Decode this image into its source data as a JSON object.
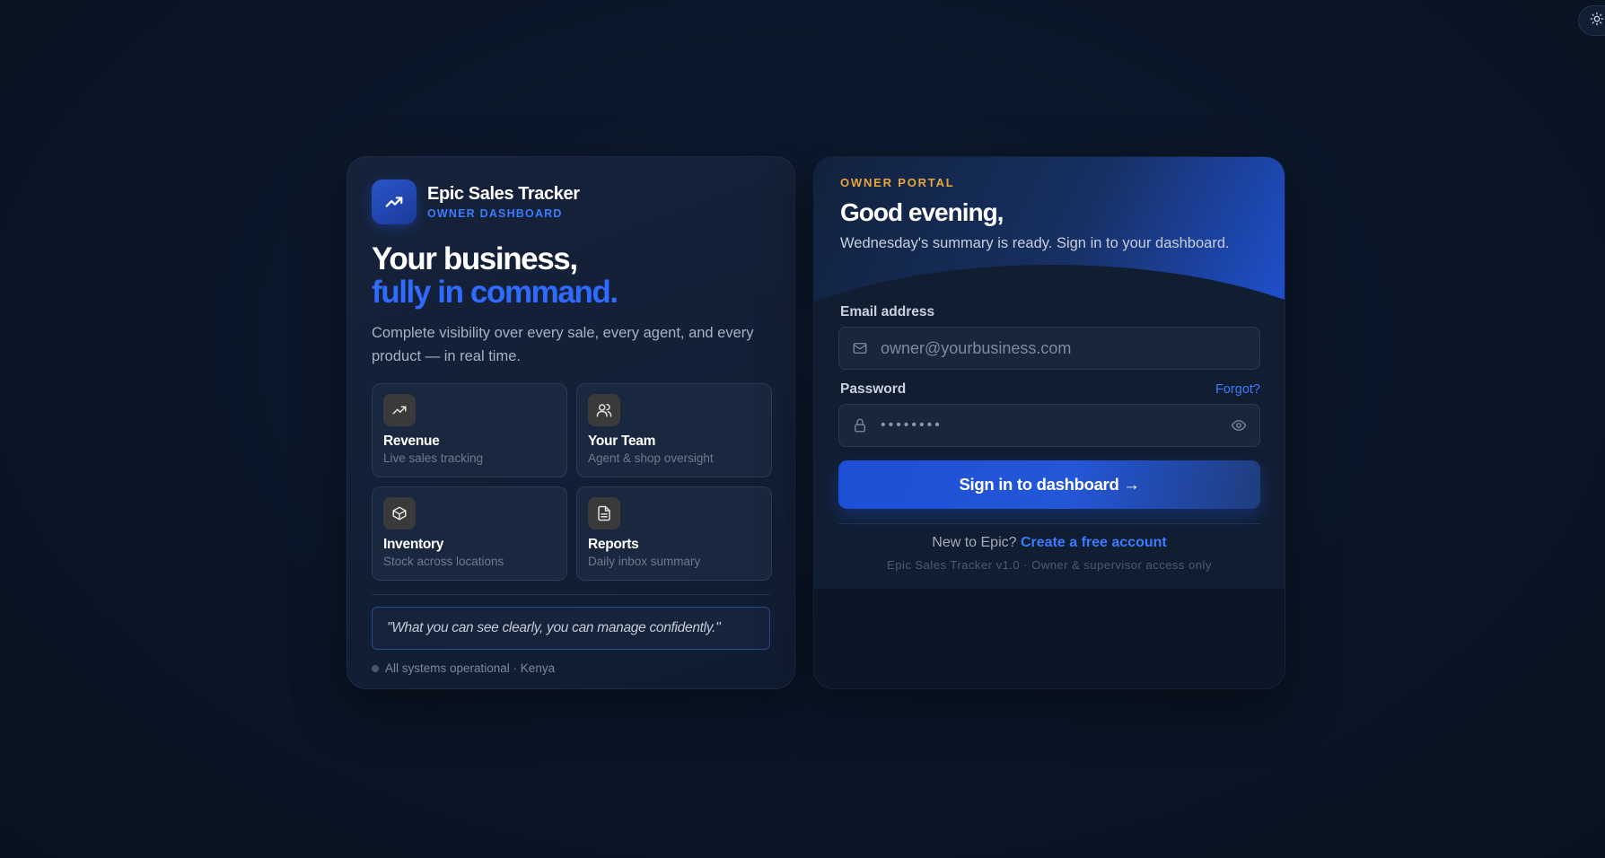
{
  "theme_toggle": {
    "icon": "sun-icon"
  },
  "brand": {
    "name": "Epic Sales Tracker",
    "subtitle": "OWNER DASHBOARD",
    "logo_icon": "trend-up-icon",
    "accent_color": "#2f6bff"
  },
  "hero_left": {
    "line1": "Your business,",
    "line2": "fully in command.",
    "description": "Complete visibility over every sale, every agent, and every product — in real time."
  },
  "features": [
    {
      "icon": "trend-up-icon",
      "title": "Revenue",
      "subtitle": "Live sales tracking"
    },
    {
      "icon": "users-icon",
      "title": "Your Team",
      "subtitle": "Agent & shop oversight"
    },
    {
      "icon": "box-icon",
      "title": "Inventory",
      "subtitle": "Stock across locations"
    },
    {
      "icon": "document-icon",
      "title": "Reports",
      "subtitle": "Daily inbox summary"
    }
  ],
  "quote": "\"What you can see clearly, you can manage confidently.\"",
  "status": "All systems operational · Kenya",
  "portal": {
    "label": "OWNER PORTAL",
    "greeting": "Good evening,",
    "summary": "Wednesday's summary is ready. Sign in to your dashboard."
  },
  "form": {
    "email_label": "Email address",
    "email_placeholder": "owner@yourbusiness.com",
    "password_label": "Password",
    "forgot_label": "Forgot?",
    "password_value": "••••••••",
    "submit_label": "Sign in to dashboard →",
    "signup_prefix": "New to Epic?",
    "signup_link": "Create a free account",
    "version": "Epic Sales Tracker v1.0 · Owner & supervisor access only"
  }
}
